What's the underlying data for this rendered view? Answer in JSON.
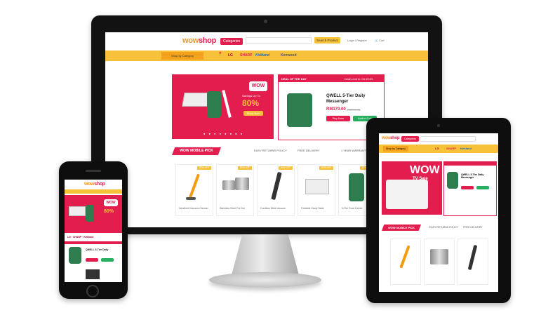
{
  "site": {
    "logo_main": "wow",
    "logo_accent": "shop",
    "categories_label": "Categories",
    "search_placeholder": "Search for products, brands and more",
    "search_button": "Search Product",
    "login_label": "Login / Register",
    "cart_label": "Cart",
    "nav_dropdown": "Shop by Category"
  },
  "brands": [
    "LG",
    "SHARP",
    "Kirkland",
    "Kenwood"
  ],
  "hero": {
    "badge": "WOW",
    "headline": "Savings Up To",
    "percent": "80%",
    "button": "Shop Now"
  },
  "promo": {
    "bar_left": "DEAL OF THE DAY",
    "bar_right": "Deals end in: 04:15:03",
    "title_line1": "QWELL 5-Tier Daily",
    "title_line2": "Messenger",
    "price": "RM379.00",
    "old_price": "RM599.00",
    "button_buy": "Buy Now",
    "button_cart": "Add to Cart"
  },
  "section": {
    "ribbon": "WOW MOBILE PICK",
    "features": [
      "EASY RETURNS POLICY",
      "FREE DELIVERY",
      "1 YEAR WARRANTY"
    ]
  },
  "products": [
    {
      "tag": "30% OFF",
      "caption": "Handheld Vacuum Cleaner"
    },
    {
      "tag": "25% OFF",
      "caption": "Stainless Steel Pot Set"
    },
    {
      "tag": "30% OFF",
      "caption": "Cordless Stick Vacuum"
    },
    {
      "tag": "20% OFF",
      "caption": "Foldable Study Table"
    },
    {
      "tag": "15% OFF",
      "caption": "5-Tier Food Carrier"
    }
  ],
  "tablet": {
    "hero_text": "WOW",
    "hero_sub": "TV Sale",
    "promo_title": "QWELL 5-Tier Daily Messenger",
    "ribbon": "WOW MOBILE PICK"
  },
  "colors": {
    "brand_red": "#e31e4f",
    "brand_yellow": "#f7c23a",
    "brand_orange": "#f7941d"
  }
}
